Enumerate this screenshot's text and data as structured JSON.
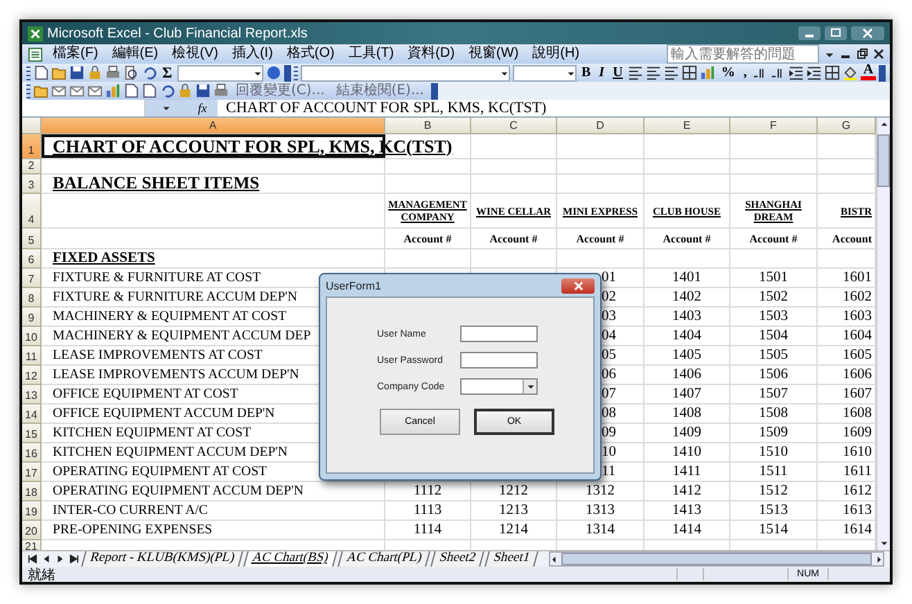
{
  "window": {
    "title": "Microsoft Excel - Club Financial Report.xls"
  },
  "menu": [
    "檔案(F)",
    "編輯(E)",
    "檢視(V)",
    "插入(I)",
    "格式(O)",
    "工具(T)",
    "資料(D)",
    "視窗(W)",
    "說明(H)"
  ],
  "help_box": {
    "placeholder": "輸入需要解答的問題"
  },
  "toolbar": {
    "sum": "Σ",
    "format": [
      "B",
      "I",
      "U"
    ],
    "number": [
      "%",
      ","
    ],
    "font_color": "A"
  },
  "review_toolbar": {
    "reply": "回覆變更(C)...",
    "end_review": "結束檢閱(E)..."
  },
  "formula_bar": {
    "fx": "fx",
    "content": "CHART OF ACCOUNT FOR SPL, KMS, KC(TST)"
  },
  "columns": [
    {
      "label": "A",
      "selected": true
    },
    {
      "label": "B",
      "selected": false
    },
    {
      "label": "C",
      "selected": false
    },
    {
      "label": "D",
      "selected": false
    },
    {
      "label": "E",
      "selected": false
    },
    {
      "label": "F",
      "selected": false
    },
    {
      "label": "G",
      "selected": false
    }
  ],
  "rows": [
    {
      "number": "1",
      "selected": true,
      "kind": "title",
      "cells": {
        "a": "CHART OF ACCOUNT FOR SPL, KMS, KC(TST)"
      }
    },
    {
      "number": "2",
      "selected": false,
      "kind": "blank",
      "cells": {}
    },
    {
      "number": "3",
      "selected": false,
      "kind": "section",
      "cells": {
        "a": "BALANCE SHEET ITEMS"
      }
    },
    {
      "number": "4",
      "selected": false,
      "kind": "header",
      "cells": {
        "b": "MANAGEMENT COMPANY",
        "c": "WINE CELLAR",
        "d": "MINI EXPRESS",
        "e": "CLUB HOUSE",
        "f": "SHANGHAI DREAM",
        "g": "BISTR"
      }
    },
    {
      "number": "5",
      "selected": false,
      "kind": "subheader",
      "cells": {
        "b": "Account #",
        "c": "Account #",
        "d": "Account #",
        "e": "Account #",
        "f": "Account #",
        "g": "Account"
      }
    },
    {
      "number": "6",
      "selected": false,
      "kind": "group",
      "cells": {
        "a": "FIXED ASSETS"
      }
    },
    {
      "number": "7",
      "selected": false,
      "kind": "item",
      "cells": {
        "a": "FIXTURE & FURNITURE AT COST",
        "d": "01",
        "e": "1401",
        "f": "1501",
        "g": "1601"
      }
    },
    {
      "number": "8",
      "selected": false,
      "kind": "item",
      "cells": {
        "a": "FIXTURE & FURNITURE ACCUM DEP'N",
        "d": "02",
        "e": "1402",
        "f": "1502",
        "g": "1602"
      }
    },
    {
      "number": "9",
      "selected": false,
      "kind": "item",
      "cells": {
        "a": "MACHINERY & EQUIPMENT AT COST",
        "d": "03",
        "e": "1403",
        "f": "1503",
        "g": "1603"
      }
    },
    {
      "number": "10",
      "selected": false,
      "kind": "item",
      "cells": {
        "a": "MACHINERY & EQUIPMENT ACCUM DEP",
        "d": "04",
        "e": "1404",
        "f": "1504",
        "g": "1604"
      }
    },
    {
      "number": "11",
      "selected": false,
      "kind": "item",
      "cells": {
        "a": "LEASE IMPROVEMENTS AT COST",
        "d": "05",
        "e": "1405",
        "f": "1505",
        "g": "1605"
      }
    },
    {
      "number": "12",
      "selected": false,
      "kind": "item",
      "cells": {
        "a": "LEASE IMPROVEMENTS ACCUM DEP'N",
        "d": "06",
        "e": "1406",
        "f": "1506",
        "g": "1606"
      }
    },
    {
      "number": "13",
      "selected": false,
      "kind": "item",
      "cells": {
        "a": "OFFICE EQUIPMENT AT COST",
        "d": "07",
        "e": "1407",
        "f": "1507",
        "g": "1607"
      }
    },
    {
      "number": "14",
      "selected": false,
      "kind": "item",
      "cells": {
        "a": "OFFICE EQUIPMENT ACCUM DEP'N",
        "d": "08",
        "e": "1408",
        "f": "1508",
        "g": "1608"
      }
    },
    {
      "number": "15",
      "selected": false,
      "kind": "item",
      "cells": {
        "a": "KITCHEN EQUIPMENT AT COST",
        "d": "09",
        "e": "1409",
        "f": "1509",
        "g": "1609"
      }
    },
    {
      "number": "16",
      "selected": false,
      "kind": "item",
      "cells": {
        "a": "KITCHEN EQUIPMENT ACCUM DEP'N",
        "d": "10",
        "e": "1410",
        "f": "1510",
        "g": "1610"
      }
    },
    {
      "number": "17",
      "selected": false,
      "kind": "item",
      "cells": {
        "a": "OPERATING EQUIPMENT AT COST",
        "d": "11",
        "e": "1411",
        "f": "1511",
        "g": "1611"
      }
    },
    {
      "number": "18",
      "selected": false,
      "kind": "item",
      "cells": {
        "a": "OPERATING EQUIPMENT ACCUM DEP'N",
        "b": "1112",
        "c": "1212",
        "d": "1312",
        "e": "1412",
        "f": "1512",
        "g": "1612"
      }
    },
    {
      "number": "19",
      "selected": false,
      "kind": "item",
      "cells": {
        "a": "INTER-CO CURRENT A/C",
        "b": "1113",
        "c": "1213",
        "d": "1313",
        "e": "1413",
        "f": "1513",
        "g": "1613"
      }
    },
    {
      "number": "20",
      "selected": false,
      "kind": "item",
      "cells": {
        "a": "PRE-OPENING EXPENSES",
        "b": "1114",
        "c": "1214",
        "d": "1314",
        "e": "1414",
        "f": "1514",
        "g": "1614"
      }
    },
    {
      "number": "21",
      "selected": false,
      "kind": "blank",
      "cells": {}
    }
  ],
  "dialog": {
    "title": "UserForm1",
    "fields": [
      {
        "label": "User Name",
        "kind": "text"
      },
      {
        "label": "User Password",
        "kind": "text"
      },
      {
        "label": "Company Code",
        "kind": "combo"
      }
    ],
    "buttons": [
      {
        "label": "Cancel",
        "default": false
      },
      {
        "label": "OK",
        "default": true
      }
    ]
  },
  "sheet_tabs": [
    {
      "label": "Report - KLUB(KMS)(PL)",
      "selected": false
    },
    {
      "label": "AC Chart(BS)",
      "selected": true
    },
    {
      "label": "AC Chart(PL)",
      "selected": false
    },
    {
      "label": "Sheet2",
      "selected": false
    },
    {
      "label": "Sheet1",
      "selected": false
    }
  ],
  "status_bar": {
    "status": "就緒",
    "num": "NUM"
  }
}
